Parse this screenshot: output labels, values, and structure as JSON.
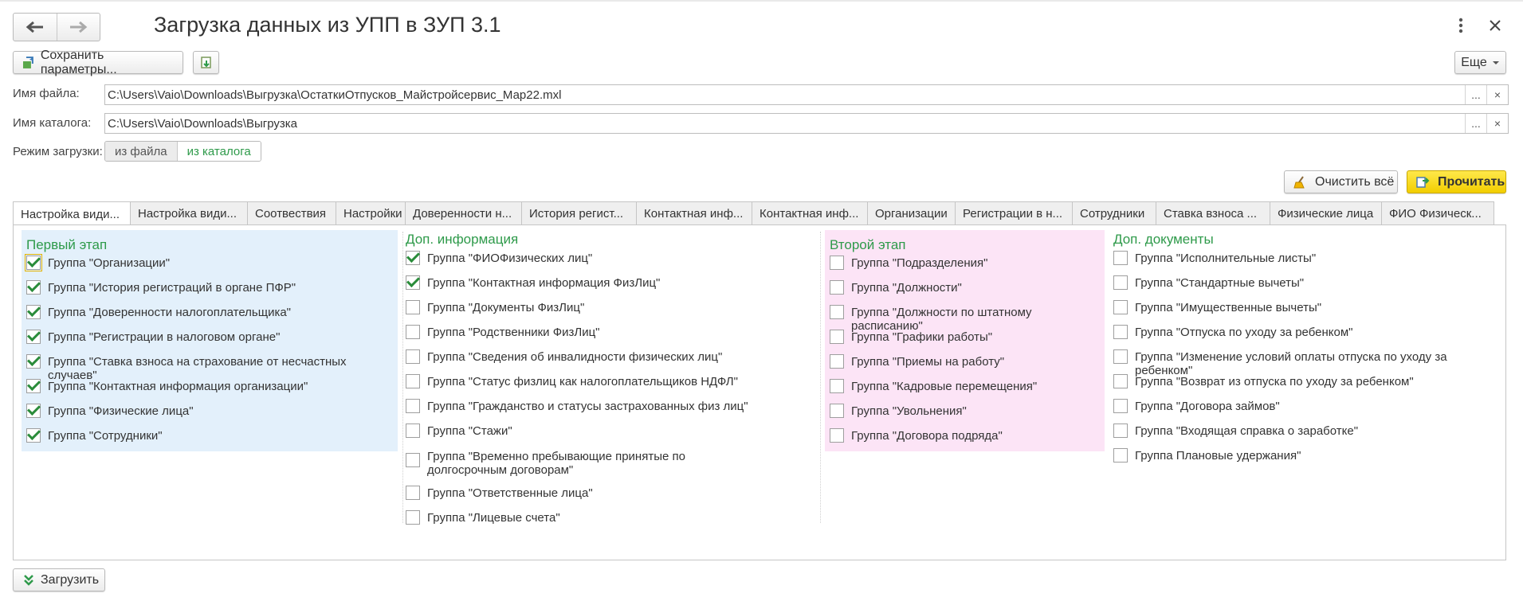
{
  "window": {
    "title": "Загрузка данных из УПП в ЗУП 3.1"
  },
  "toolbar": {
    "save_label": "Сохранить параметры...",
    "more_label": "Еще"
  },
  "fields": {
    "file_label": "Имя файла:",
    "file_value": "C:\\Users\\Vaio\\Downloads\\Выгрузка\\ОстаткиОтпусков_Майстройсервис_Мар22.mxl",
    "dir_label": "Имя каталога:",
    "dir_value": "C:\\Users\\Vaio\\Downloads\\Выгрузка",
    "select_glyph": "...",
    "clear_glyph": "×"
  },
  "mode": {
    "label": "Режим загрузки:",
    "option_file": "из файла",
    "option_dir": "из каталога",
    "selected": "из каталога"
  },
  "actions": {
    "clear_all": "Очистить всё",
    "read": "Прочитать",
    "load": "Загрузить"
  },
  "tabs": [
    "Настройка види...",
    "Настройка види...",
    "Соотвествия",
    "Настройки",
    "Доверенности н...",
    "История регист...",
    "Контактная инф...",
    "Контактная инф...",
    "Организации",
    "Регистрации в н...",
    "Сотрудники",
    "Ставка взноса ...",
    "Физические лица",
    "ФИО Физическ..."
  ],
  "groups": {
    "first": {
      "title": "Первый этап",
      "bg": "#e3f0fb",
      "items": [
        {
          "label": "Группа \"Организации\"",
          "checked": true
        },
        {
          "label": "Группа \"История регистраций в органе ПФР\"",
          "checked": true
        },
        {
          "label": "Группа \"Доверенности налогоплательщика\"",
          "checked": true
        },
        {
          "label": "Группа \"Регистрации в налоговом органе\"",
          "checked": true
        },
        {
          "label": "Группа \"Ставка взноса на страхование от несчастных случаев\"",
          "checked": true
        },
        {
          "label": "Группа \"Контактная информация организации\"",
          "checked": true
        },
        {
          "label": "Группа \"Физические лица\"",
          "checked": true
        },
        {
          "label": "Группа \"Сотрудники\"",
          "checked": true
        }
      ]
    },
    "extra_info": {
      "title": "Доп. информация",
      "items": [
        {
          "label": "Группа \"ФИОФизических лиц\"",
          "checked": true
        },
        {
          "label": "Группа \"Контактная информация ФизЛиц\"",
          "checked": true
        },
        {
          "label": "Группа \"Документы ФизЛиц\"",
          "checked": false
        },
        {
          "label": "Группа \"Родственники ФизЛиц\"",
          "checked": false
        },
        {
          "label": "Группа \"Сведения об инвалидности физических лиц\"",
          "checked": false
        },
        {
          "label": "Группа \"Статус физлиц как налогоплательщиков НДФЛ\"",
          "checked": false
        },
        {
          "label": "Группа \"Гражданство и статусы застрахованных физ лиц\"",
          "checked": false
        },
        {
          "label": "Группа \"Стажи\"",
          "checked": false
        },
        {
          "label": "Группа \"Временно пребывающие принятые по долгосрочным договорам\"",
          "checked": false
        },
        {
          "label": "Группа \"Ответственные лица\"",
          "checked": false
        },
        {
          "label": "Группа \"Лицевые счета\"",
          "checked": false
        }
      ]
    },
    "second": {
      "title": "Второй этап",
      "bg": "#fce4f6",
      "items": [
        {
          "label": "Группа \"Подразделения\"",
          "checked": false
        },
        {
          "label": "Группа \"Должности\"",
          "checked": false
        },
        {
          "label": "Группа \"Должности по штатному расписанию\"",
          "checked": false
        },
        {
          "label": "Группа \"Графики работы\"",
          "checked": false
        },
        {
          "label": "Группа \"Приемы на работу\"",
          "checked": false
        },
        {
          "label": "Группа \"Кадровые перемещения\"",
          "checked": false
        },
        {
          "label": "Группа \"Увольнения\"",
          "checked": false
        },
        {
          "label": "Группа \"Договора подряда\"",
          "checked": false
        }
      ]
    },
    "extra_docs": {
      "title": "Доп. документы",
      "items": [
        {
          "label": "Группа \"Исполнительные листы\"",
          "checked": false
        },
        {
          "label": "Группа \"Стандартные вычеты\"",
          "checked": false
        },
        {
          "label": "Группа \"Имущественные вычеты\"",
          "checked": false
        },
        {
          "label": "Группа \"Отпуска по уходу за ребенком\"",
          "checked": false
        },
        {
          "label": "Группа \"Изменение условий оплаты отпуска по уходу за ребенком\"",
          "checked": false
        },
        {
          "label": "Группа \"Возврат из отпуска по уходу за ребенком\"",
          "checked": false
        },
        {
          "label": "Группа \"Договора займов\"",
          "checked": false
        },
        {
          "label": "Группа \"Входящая справка о заработке\"",
          "checked": false
        },
        {
          "label": "Группа Плановые удержания\"",
          "checked": false
        }
      ]
    }
  },
  "colors": {
    "accent_green": "#2e9a4a",
    "read_button": "#f5d400"
  }
}
